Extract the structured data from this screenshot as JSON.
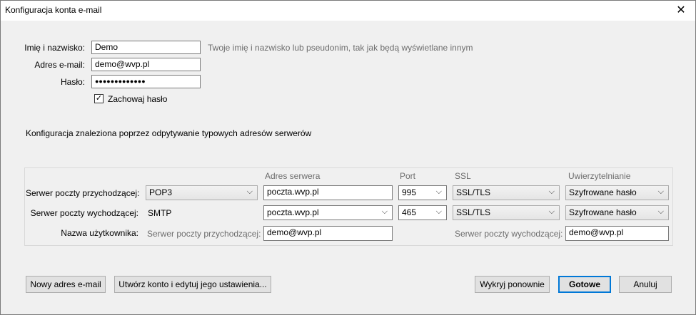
{
  "window": {
    "title": "Konfiguracja konta e-mail"
  },
  "identity": {
    "name_label": "Imię i nazwisko:",
    "name_value": "Demo",
    "name_hint": "Twoje imię i nazwisko lub pseudonim, tak jak będą wyświetlane innym",
    "email_label": "Adres e-mail:",
    "email_value": "demo@wvp.pl",
    "password_label": "Hasło:",
    "password_value": "●●●●●●●●●●●●●",
    "remember_label": "Zachowaj hasło",
    "remember_checked": true
  },
  "status_message": "Konfiguracja znaleziona poprzez odpytywanie typowych adresów serwerów",
  "server_table": {
    "headers": {
      "address": "Adres serwera",
      "port": "Port",
      "ssl": "SSL",
      "auth": "Uwierzytelnianie"
    },
    "incoming": {
      "label": "Serwer poczty przychodzącej:",
      "protocol": "POP3",
      "address": "poczta.wvp.pl",
      "port": "995",
      "ssl": "SSL/TLS",
      "auth": "Szyfrowane hasło"
    },
    "outgoing": {
      "label": "Serwer poczty wychodzącej:",
      "protocol": "SMTP",
      "address": "poczta.wvp.pl",
      "port": "465",
      "ssl": "SSL/TLS",
      "auth": "Szyfrowane hasło"
    },
    "username": {
      "label": "Nazwa użytkownika:",
      "incoming_label": "Serwer poczty przychodzącej:",
      "incoming_value": "demo@wvp.pl",
      "outgoing_label": "Serwer poczty wychodzącej:",
      "outgoing_value": "demo@wvp.pl"
    }
  },
  "buttons": {
    "new_email": "Nowy adres e-mail",
    "create_edit": "Utwórz konto i edytuj jego ustawienia...",
    "redetect": "Wykryj ponownie",
    "done": "Gotowe",
    "cancel": "Anuluj"
  },
  "icons": {
    "close": "close-icon",
    "dropdown": "chevron-down-icon",
    "check": "check-icon"
  }
}
